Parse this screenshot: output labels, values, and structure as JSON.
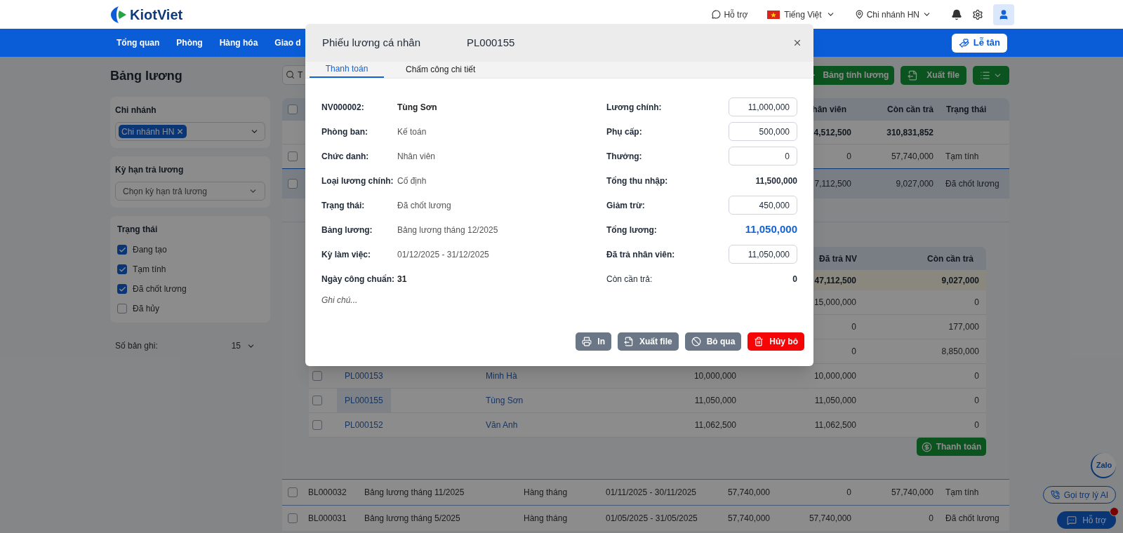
{
  "header": {
    "logo": "KiotViet",
    "support": "Hỗ trợ",
    "language": "Tiếng Việt",
    "branch": "Chi nhánh HN"
  },
  "nav": {
    "items": [
      {
        "label": "Tổng quan"
      },
      {
        "label": "Phòng"
      },
      {
        "label": "Hàng hóa"
      },
      {
        "label": "Giao d"
      }
    ],
    "reception_button": "Lễ tân"
  },
  "sidebar": {
    "title": "Bảng lương",
    "branch_filter": {
      "label": "Chi nhánh",
      "tag": "Chi nhánh HN"
    },
    "period_filter": {
      "label": "Kỳ hạn trả lương",
      "placeholder": "Chọn kỳ hạn trả lương"
    },
    "status_filter": {
      "label": "Trạng thái",
      "options": [
        {
          "label": "Đang tạo",
          "checked": true
        },
        {
          "label": "Tạm tính",
          "checked": true
        },
        {
          "label": "Đã chốt lương",
          "checked": true
        },
        {
          "label": "Đã hủy",
          "checked": false
        }
      ]
    },
    "page_size": {
      "label": "Số bản ghi:",
      "value": "15"
    }
  },
  "toolbar": {
    "search_placeholder": "T",
    "create_button": "Bảng tính lương",
    "export_button": "Xuất file"
  },
  "table": {
    "header": {
      "checked": false,
      "paid": "hân viên",
      "remaining": "Còn cần trả",
      "status": "Trạng thái"
    },
    "summary": {
      "paid": "4,512,500",
      "remaining": "310,831,852"
    },
    "rows": [
      {
        "checked": false,
        "expanded": false,
        "paid": "0",
        "remaining": "57,740,000",
        "status": "Tạm tính"
      },
      {
        "checked": false,
        "expanded": true,
        "paid": "7,112,500",
        "remaining": "9,027,000",
        "status": "Đã chốt lương",
        "detail": {
          "header": {
            "paid": "Đã trả NV",
            "remaining": "Còn cần trả"
          },
          "summary": {
            "paid": "47,112,500",
            "remaining": "9,027,000"
          },
          "rows": [
            {
              "paid": "15,000,000",
              "remaining": "0"
            },
            {
              "paid": "0",
              "remaining": "177,000"
            },
            {
              "paid": "0",
              "remaining": "8,850,000"
            },
            {
              "checked": false,
              "selected": false,
              "code": "PL000153",
              "name": "Minh Hà",
              "amount": "10,000,000",
              "paid": "10,000,000",
              "remaining": "0"
            },
            {
              "checked": false,
              "selected": true,
              "code": "PL000155",
              "name": "Tùng Sơn",
              "amount": "11,050,000",
              "paid": "11,050,000",
              "remaining": "0"
            },
            {
              "checked": false,
              "selected": false,
              "code": "PL000152",
              "name": "Văn Anh",
              "amount": "11,062,500",
              "paid": "11,062,500",
              "remaining": "0"
            }
          ],
          "pay_button": "Thanh toán"
        }
      },
      {
        "checked": false,
        "expanded": false,
        "code": "BL000032",
        "name": "Bảng lương tháng 11/2025",
        "type": "Hàng tháng",
        "period": "01/11/2025 - 30/11/2025",
        "total": "57,740,000",
        "paid": "0",
        "remaining": "57,740,000",
        "status": "Tạm tính"
      },
      {
        "checked": false,
        "expanded": false,
        "code": "BL000031",
        "name": "Bảng lương tháng 5/2025",
        "type": "Hàng tháng",
        "period": "01/05/2025 - 31/05/2025",
        "total": "57,740,000",
        "paid": "57,740,000",
        "remaining": "0",
        "status": "Đã chốt lương"
      }
    ]
  },
  "dialog": {
    "title": "Phiếu lương cá nhân",
    "code": "PL000155",
    "tabs": [
      {
        "label": "Thanh toán",
        "selected": true
      },
      {
        "label": "Chấm công chi tiết",
        "selected": false
      }
    ],
    "info": [
      {
        "label": "NV000002:",
        "value": "Tùng Sơn",
        "emphasis": true
      },
      {
        "label": "Phòng ban:",
        "value": "Kế toán",
        "emphasis": false
      },
      {
        "label": "Chức danh:",
        "value": "Nhân viên",
        "emphasis": false
      },
      {
        "label": "Loại lương chính:",
        "value": "Cố định",
        "emphasis": false
      },
      {
        "label": "Trạng thái:",
        "value": "Đã chốt lương",
        "emphasis": false
      },
      {
        "label": "Bảng lương:",
        "value": "Bảng lương tháng 12/2025",
        "emphasis": false
      },
      {
        "label": "Kỳ làm việc:",
        "value": "01/12/2025 - 31/12/2025",
        "emphasis": false
      },
      {
        "label": "Ngày công chuẩn:",
        "value": "31",
        "emphasis": true
      }
    ],
    "amounts": [
      {
        "label": "Lương chính:",
        "kind": "input",
        "value": "11,000,000"
      },
      {
        "label": "Phụ cấp:",
        "kind": "input",
        "value": "500,000"
      },
      {
        "label": "Thưởng:",
        "kind": "input",
        "value": "0"
      },
      {
        "label": "Tổng thu nhập:",
        "kind": "text",
        "value": "11,500,000"
      },
      {
        "label": "Giảm trừ:",
        "kind": "input",
        "value": "450,000"
      },
      {
        "label": "Tổng lương:",
        "kind": "total",
        "value": "11,050,000"
      },
      {
        "label": "Đã trả nhân viên:",
        "kind": "input",
        "value": "11,050,000"
      },
      {
        "label": "Còn cần trả:",
        "kind": "text",
        "value": "0"
      }
    ],
    "note_placeholder": "Ghi chú...",
    "buttons": [
      {
        "label": "In",
        "kind": "print"
      },
      {
        "label": "Xuất file",
        "kind": "export"
      },
      {
        "label": "Bỏ qua",
        "kind": "skip"
      },
      {
        "label": "Hủy bỏ",
        "kind": "delete"
      }
    ]
  },
  "floating": {
    "zalo": "Zalo",
    "ai_button": "Gọi trợ lý AI",
    "support_button": "Hỗ trợ"
  }
}
